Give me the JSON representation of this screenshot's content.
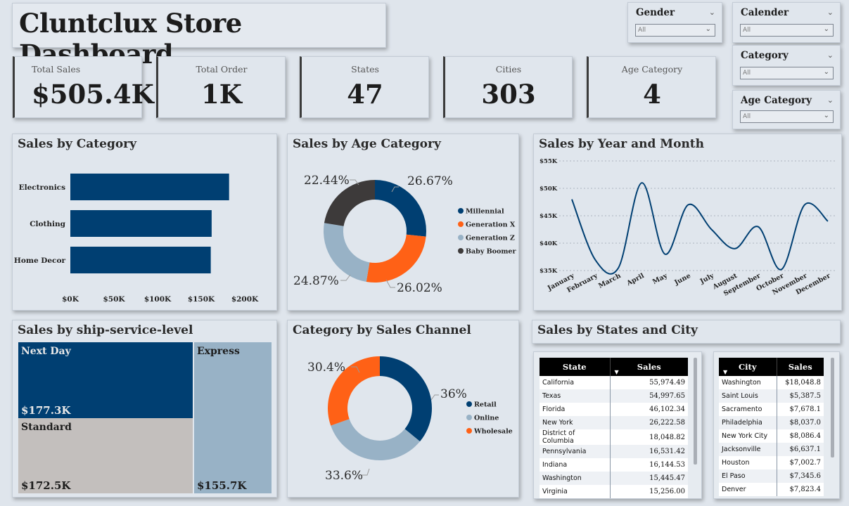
{
  "title": "Cluntclux Store Dashboard",
  "kpis": [
    {
      "label": "Total Sales",
      "value": "$505.4K"
    },
    {
      "label": "Total Order",
      "value": "1K"
    },
    {
      "label": "States",
      "value": "47"
    },
    {
      "label": "Cities",
      "value": "303"
    },
    {
      "label": "Age Category",
      "value": "4"
    }
  ],
  "slicers": [
    {
      "title": "Gender",
      "value": "All"
    },
    {
      "title": "Calender",
      "value": "All"
    },
    {
      "title": "Category",
      "value": "All"
    },
    {
      "title": "Age Category",
      "value": "All"
    }
  ],
  "panels": {
    "category": "Sales by Category",
    "age": "Sales by Age Category",
    "year_month": "Sales by Year and Month",
    "ship": "Sales by ship-service-level",
    "channel": "Category by Sales Channel",
    "states_city": "Sales by States and City"
  },
  "colors": {
    "navy": "#003f72",
    "orange": "#ff6116",
    "lightblue": "#98b2c6",
    "dark": "#3d3a3a",
    "grey": "#c3bfbd"
  },
  "chart_data": [
    {
      "id": "category",
      "type": "bar",
      "orientation": "horizontal",
      "categories": [
        "Electronics",
        "Clothing",
        "Home Decor"
      ],
      "values": [
        182,
        162,
        161
      ],
      "xticks": [
        "$0K",
        "$50K",
        "$100K",
        "$150K",
        "$200K"
      ],
      "xlim": [
        0,
        200
      ],
      "color": "#003f72"
    },
    {
      "id": "age",
      "type": "pie",
      "donut": true,
      "labels": [
        "Millennial",
        "Generation X",
        "Generation Z",
        "Baby Boomer"
      ],
      "values": [
        26.67,
        26.02,
        24.87,
        22.44
      ],
      "value_labels": [
        "26.67%",
        "26.02%",
        "24.87%",
        "22.44%"
      ],
      "colors": [
        "#003f72",
        "#ff6116",
        "#98b2c6",
        "#3d3a3a"
      ],
      "legend": "right"
    },
    {
      "id": "year_month",
      "type": "line",
      "categories": [
        "January",
        "February",
        "March",
        "April",
        "May",
        "June",
        "July",
        "August",
        "September",
        "October",
        "November",
        "December"
      ],
      "values": [
        48,
        37,
        35.5,
        51,
        38,
        47,
        42.5,
        39,
        43,
        35.2,
        47,
        44
      ],
      "yticks": [
        "$35K",
        "$40K",
        "$45K",
        "$50K",
        "$55K"
      ],
      "ylim": [
        35,
        55
      ],
      "grid": true,
      "color": "#003f72"
    },
    {
      "id": "ship",
      "type": "treemap",
      "labels": [
        "Next Day",
        "Standard",
        "Express"
      ],
      "values": [
        177.3,
        172.5,
        155.7
      ],
      "value_labels": [
        "$177.3K",
        "$172.5K",
        "$155.7K"
      ],
      "colors": [
        "#003f72",
        "#c3bfbd",
        "#98b2c6"
      ]
    },
    {
      "id": "channel",
      "type": "pie",
      "donut": true,
      "labels": [
        "Retail",
        "Online",
        "Wholesale"
      ],
      "values": [
        36,
        33.6,
        30.4
      ],
      "value_labels": [
        "36%",
        "33.6%",
        "30.4%"
      ],
      "colors": [
        "#003f72",
        "#98b2c6",
        "#ff6116"
      ],
      "legend": "right"
    },
    {
      "id": "states",
      "type": "table",
      "columns": [
        "State",
        "Sales"
      ],
      "rows": [
        [
          "California",
          "55,974.49"
        ],
        [
          "Texas",
          "54,997.65"
        ],
        [
          "Florida",
          "46,102.34"
        ],
        [
          "New York",
          "26,222.58"
        ],
        [
          "District of Columbia",
          "18,048.82"
        ],
        [
          "Pennsylvania",
          "16,531.42"
        ],
        [
          "Indiana",
          "16,144.53"
        ],
        [
          "Washington",
          "15,445.47"
        ],
        [
          "Virginia",
          "15,256.00"
        ]
      ]
    },
    {
      "id": "cities",
      "type": "table",
      "columns": [
        "City",
        "Sales"
      ],
      "rows": [
        [
          "Washington",
          "$18,048.8"
        ],
        [
          "Saint Louis",
          "$5,387.5"
        ],
        [
          "Sacramento",
          "$7,678.1"
        ],
        [
          "Philadelphia",
          "$8,037.0"
        ],
        [
          "New York City",
          "$8,086.4"
        ],
        [
          "Jacksonville",
          "$6,637.1"
        ],
        [
          "Houston",
          "$7,002.7"
        ],
        [
          "El Paso",
          "$7,345.6"
        ],
        [
          "Denver",
          "$7,823.4"
        ]
      ]
    }
  ]
}
